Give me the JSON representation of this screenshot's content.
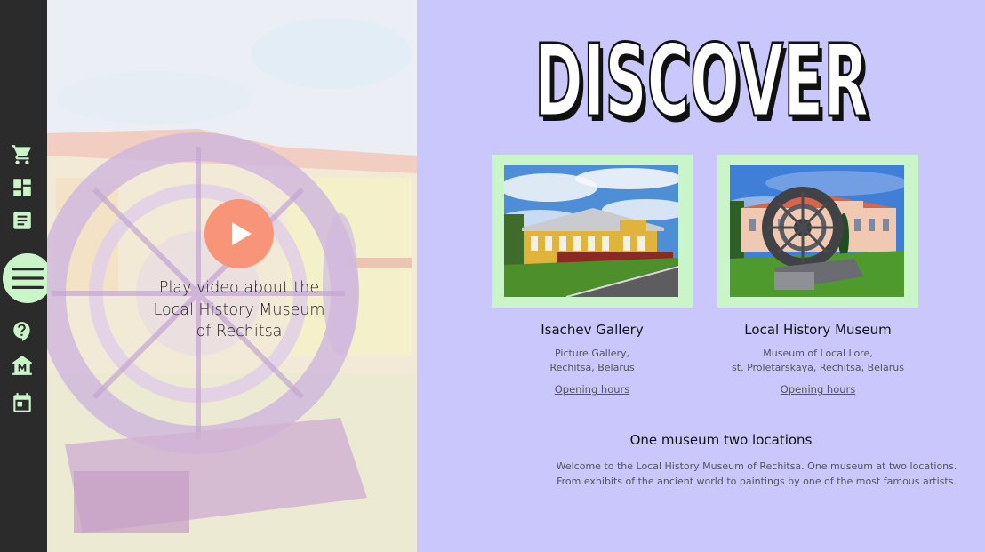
{
  "sidebar": {
    "icons": [
      "cart-icon",
      "dashboard-icon",
      "article-icon",
      "menu-icon",
      "help-icon",
      "museum-icon",
      "calendar-icon"
    ]
  },
  "hero": {
    "caption_line1": "Play video about the",
    "caption_line2": "Local History Museum",
    "caption_line3": "of Rechitsa"
  },
  "discover": {
    "title": "DISCOVER"
  },
  "locations": [
    {
      "name": "Isachev Gallery",
      "desc_line1": "Picture Gallery,",
      "desc_line2": "Rechitsa, Belarus",
      "link": "Opening hours"
    },
    {
      "name": "Local History Museum",
      "desc_line1": "Museum of Local Lore,",
      "desc_line2": "st. Proletarskaya, Rechitsa, Belarus",
      "link": "Opening hours"
    }
  ],
  "about": {
    "title": "One museum two locations",
    "line1": "Welcome to the Local History Museum of Rechitsa. One museum at two locations.",
    "line2": "From exhibits of the ancient world to paintings by one of the most famous artists."
  },
  "colors": {
    "sidebar": "#2b2b2b",
    "panel": "#c9c7fb",
    "accent_green": "#c9f5c8",
    "play": "#f89478"
  }
}
